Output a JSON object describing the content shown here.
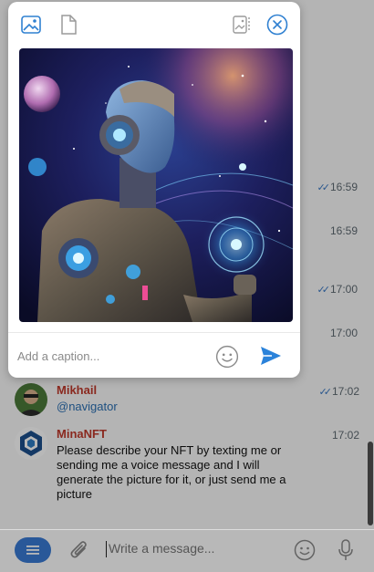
{
  "chat": {
    "time_rows": [
      {
        "time": "16:59",
        "read": true
      },
      {
        "time": "16:59",
        "read": false
      },
      {
        "time": "17:00",
        "read": true
      },
      {
        "time": "17:00",
        "read": false
      }
    ],
    "messages": [
      {
        "name": "Mikhail",
        "text": "@navigator",
        "time": "17:02",
        "read": true,
        "name_color": "#c0392b",
        "text_color": "#2a6fb3"
      },
      {
        "name": "MinaNFT",
        "text": "Please describe your NFT by texting me or sending me a voice message and I will generate the picture for it, or just send me a picture",
        "time": "17:02",
        "read": false,
        "name_color": "#c0392b",
        "text_color": "#111111"
      }
    ]
  },
  "composer": {
    "placeholder": "Write a message...",
    "accent": "#3a7bd5"
  },
  "modal": {
    "caption_placeholder": "Add a caption...",
    "icons": [
      "image-mode-icon",
      "file-mode-icon",
      "compress-toggle-icon",
      "close-icon"
    ],
    "send_color": "#2a82da"
  }
}
